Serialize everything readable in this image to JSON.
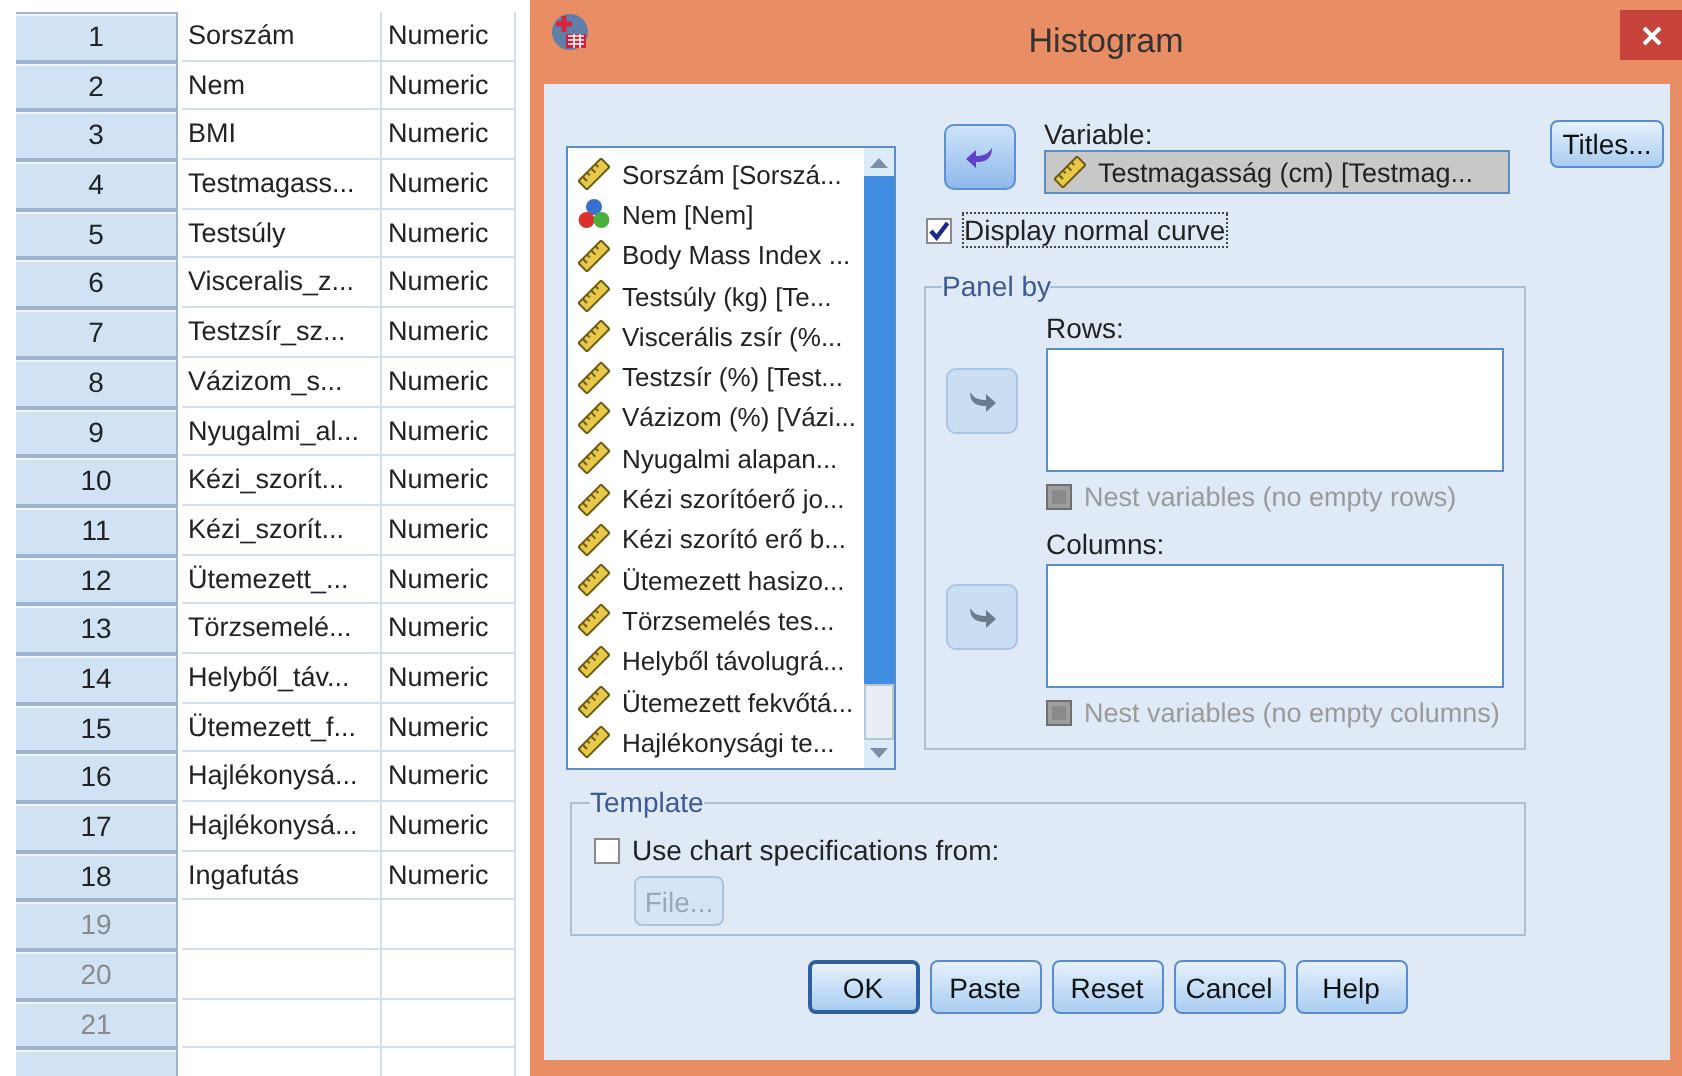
{
  "data_grid": {
    "rows": [
      {
        "number": "1",
        "name": "Sorszám",
        "type": "Numeric"
      },
      {
        "number": "2",
        "name": "Nem",
        "type": "Numeric"
      },
      {
        "number": "3",
        "name": "BMI",
        "type": "Numeric"
      },
      {
        "number": "4",
        "name": "Testmagass...",
        "type": "Numeric"
      },
      {
        "number": "5",
        "name": "Testsúly",
        "type": "Numeric"
      },
      {
        "number": "6",
        "name": "Visceralis_z...",
        "type": "Numeric"
      },
      {
        "number": "7",
        "name": "Testzsír_sz...",
        "type": "Numeric"
      },
      {
        "number": "8",
        "name": "Vázizom_s...",
        "type": "Numeric"
      },
      {
        "number": "9",
        "name": "Nyugalmi_al...",
        "type": "Numeric"
      },
      {
        "number": "10",
        "name": "Kézi_szorít...",
        "type": "Numeric"
      },
      {
        "number": "11",
        "name": "Kézi_szorít...",
        "type": "Numeric"
      },
      {
        "number": "12",
        "name": "Ütemezett_...",
        "type": "Numeric"
      },
      {
        "number": "13",
        "name": "Törzsemelé...",
        "type": "Numeric"
      },
      {
        "number": "14",
        "name": "Helyből_táv...",
        "type": "Numeric"
      },
      {
        "number": "15",
        "name": "Ütemezett_f...",
        "type": "Numeric"
      },
      {
        "number": "16",
        "name": "Hajlékonysá...",
        "type": "Numeric"
      },
      {
        "number": "17",
        "name": "Hajlékonysá...",
        "type": "Numeric"
      },
      {
        "number": "18",
        "name": "Ingafutás",
        "type": "Numeric"
      },
      {
        "number": "19"
      },
      {
        "number": "20"
      },
      {
        "number": "21"
      },
      {}
    ]
  },
  "dialog": {
    "title": "Histogram",
    "variable_list": {
      "items": [
        {
          "label": "Sorszám [Sorszá...",
          "kind": "scale"
        },
        {
          "label": "Nem [Nem]",
          "kind": "nominal"
        },
        {
          "label": "Body Mass Index ...",
          "kind": "scale"
        },
        {
          "label": "Testsúly (kg) [Te...",
          "kind": "scale"
        },
        {
          "label": "Viscerális zsír (%...",
          "kind": "scale"
        },
        {
          "label": "Testzsír (%) [Test...",
          "kind": "scale"
        },
        {
          "label": "Vázizom (%) [Vázi...",
          "kind": "scale"
        },
        {
          "label": "Nyugalmi alapan...",
          "kind": "scale"
        },
        {
          "label": "Kézi szorítóerő jo...",
          "kind": "scale"
        },
        {
          "label": "Kézi szorító erő b...",
          "kind": "scale"
        },
        {
          "label": "Ütemezett hasizo...",
          "kind": "scale"
        },
        {
          "label": "Törzsemelés tes...",
          "kind": "scale"
        },
        {
          "label": "Helyből távolugrá...",
          "kind": "scale"
        },
        {
          "label": "Ütemezett fekvőtá...",
          "kind": "scale"
        },
        {
          "label": "Hajlékonysági te...",
          "kind": "scale"
        }
      ]
    },
    "variable": {
      "label": "Variable:",
      "value": "Testmagasság (cm) [Testmag...",
      "kind": "scale",
      "move_button": {
        "kind": "back",
        "disabled": false
      }
    },
    "titles_button": {
      "label": "Titles..."
    },
    "display_normal_curve": {
      "label": "Display normal curve",
      "checked": true
    },
    "panel_by": {
      "title": "Panel by",
      "groups": [
        {
          "label": "Rows:",
          "move_button": {
            "kind": "forward",
            "disabled": true
          },
          "nest": {
            "label": "Nest variables (no empty rows)",
            "checked": false,
            "disabled": true
          }
        },
        {
          "label": "Columns:",
          "move_button": {
            "kind": "forward",
            "disabled": true
          },
          "nest": {
            "label": "Nest variables (no empty columns)",
            "checked": false,
            "disabled": true
          }
        }
      ]
    },
    "template": {
      "title": "Template",
      "use_chart_specs": {
        "label": "Use chart specifications from:",
        "checked": false
      },
      "file_button": {
        "label": "File...",
        "disabled": true
      }
    },
    "buttons": [
      {
        "label": "OK",
        "default": true
      },
      {
        "label": "Paste",
        "default": false
      },
      {
        "label": "Reset",
        "default": false
      },
      {
        "label": "Cancel",
        "default": false
      },
      {
        "label": "Help",
        "default": false
      }
    ]
  }
}
